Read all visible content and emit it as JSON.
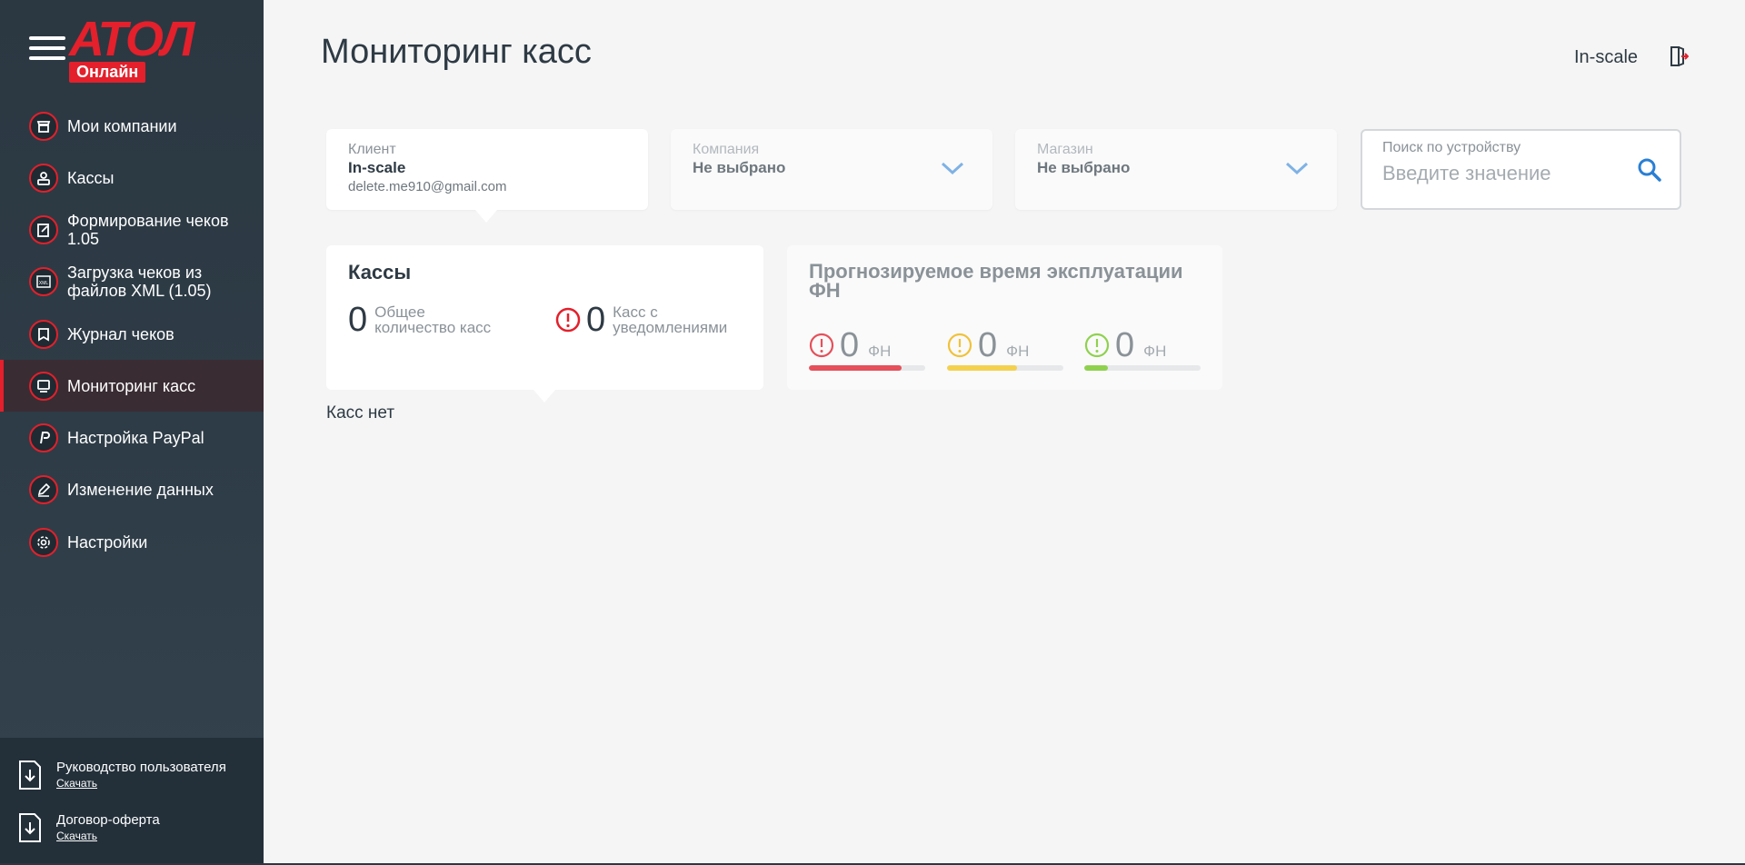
{
  "brand": {
    "logo_text": "АТОЛ",
    "badge": "Онлайн",
    "accent": "#e3202b"
  },
  "sidebar": {
    "items": [
      {
        "label": "Мои компании",
        "icon": "store-icon",
        "active": false
      },
      {
        "label": "Кассы",
        "icon": "cash-register-icon",
        "active": false
      },
      {
        "label": "Формирование чеков 1.05",
        "icon": "edit-receipt-icon",
        "active": false
      },
      {
        "label": "Загрузка чеков из файлов XML (1.05)",
        "icon": "xml-file-icon",
        "active": false
      },
      {
        "label": "Журнал чеков",
        "icon": "bookmark-icon",
        "active": false
      },
      {
        "label": "Мониторинг касс",
        "icon": "monitor-icon",
        "active": true
      },
      {
        "label": "Настройка PayPal",
        "icon": "paypal-icon",
        "active": false
      },
      {
        "label": "Изменение данных",
        "icon": "pencil-icon",
        "active": false
      },
      {
        "label": "Настройки",
        "icon": "gear-icon",
        "active": false
      }
    ],
    "docs": [
      {
        "title": "Руководство пользователя",
        "link": "Скачать"
      },
      {
        "title": "Договор-оферта",
        "link": "Скачать"
      }
    ]
  },
  "header": {
    "title": "Мониторинг касс",
    "user": "In-scale"
  },
  "filters": {
    "client": {
      "label": "Клиент",
      "value": "In-scale",
      "email": "delete.me910@gmail.com"
    },
    "company": {
      "label": "Компания",
      "value": "Не выбрано"
    },
    "store": {
      "label": "Магазин",
      "value": "Не выбрано"
    },
    "search": {
      "label": "Поиск по устройству",
      "placeholder": "Введите значение"
    }
  },
  "kassy_card": {
    "title": "Кассы",
    "total": "0",
    "total_label_1": "Общее",
    "total_label_2": "количество касс",
    "notified": "0",
    "notified_label_1": "Касс с",
    "notified_label_2": "уведомлениями"
  },
  "fn_card": {
    "title": "Прогнозируемое время эксплуатации ФН",
    "items": [
      {
        "count": "0",
        "unit": "ФН",
        "color": "#e5505a",
        "fill": 0.8
      },
      {
        "count": "0",
        "unit": "ФН",
        "color": "#f4d04f",
        "fill": 0.6
      },
      {
        "count": "0",
        "unit": "ФН",
        "color": "#8fd14f",
        "fill": 0.2
      }
    ]
  },
  "empty_message": "Касс нет"
}
